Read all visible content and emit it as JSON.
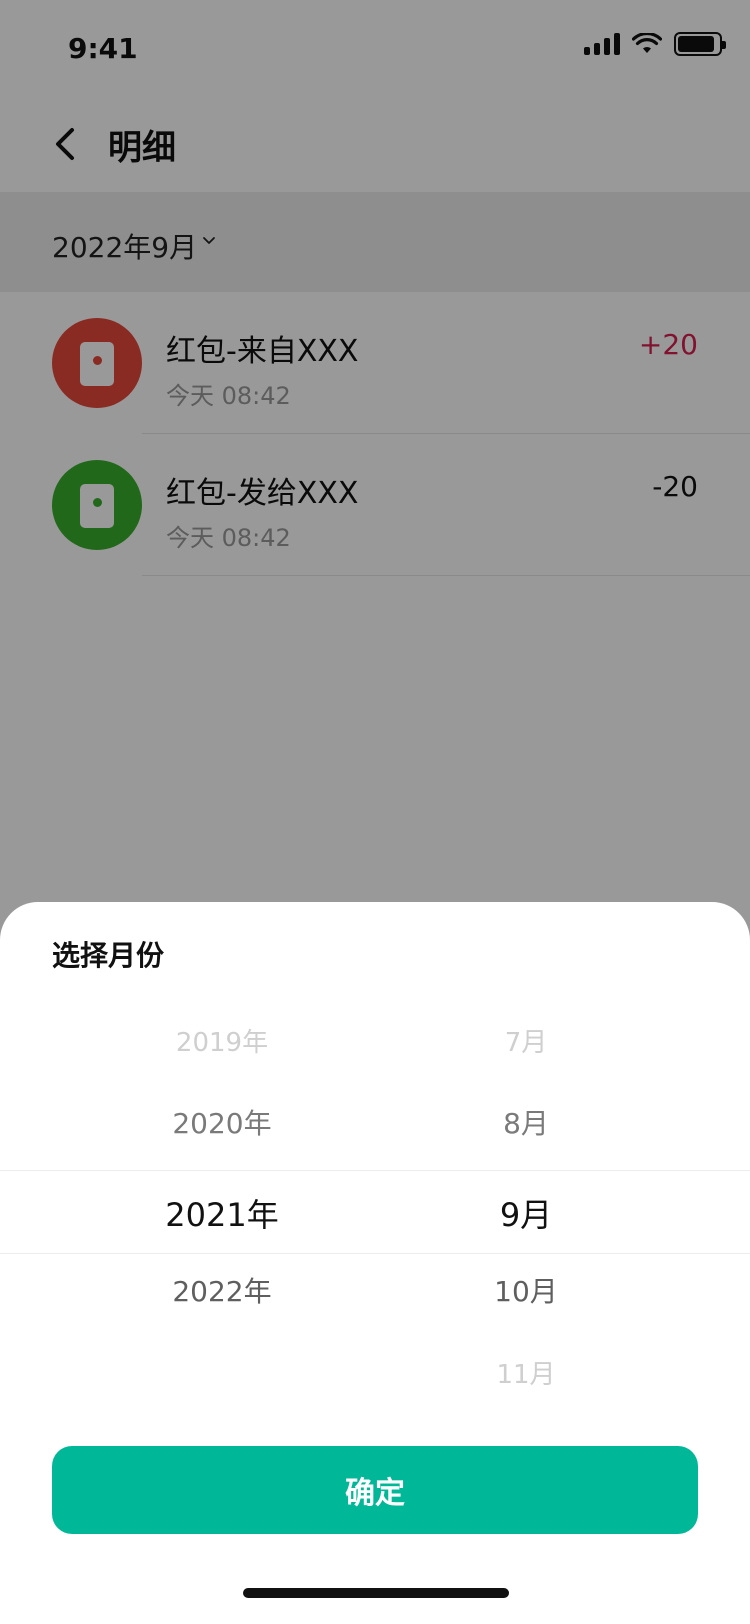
{
  "status_bar": {
    "time": "9:41"
  },
  "nav": {
    "title": "明细"
  },
  "filter": {
    "label": "2022年9月"
  },
  "transactions": [
    {
      "title": "红包-来自XXX",
      "time": "今天 08:42",
      "amount": "+20",
      "amount_color": "#d81e51",
      "avatar_color": "#e4473b"
    },
    {
      "title": "红包-发给XXX",
      "time": "今天 08:42",
      "amount": "-20",
      "amount_color": "#111111",
      "avatar_color": "#3aad2e"
    }
  ],
  "sheet": {
    "title": "选择月份",
    "years": [
      "2019年",
      "2020年",
      "2021年",
      "2022年"
    ],
    "months": [
      "7月",
      "8月",
      "9月",
      "10月",
      "11月"
    ],
    "confirm_label": "确定"
  },
  "colors": {
    "primary": "#00b898",
    "overlay": "rgba(0,0,0,0.40)"
  }
}
